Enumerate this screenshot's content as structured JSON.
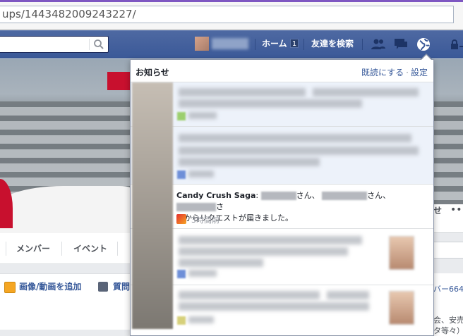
{
  "browser": {
    "url": "ups/1443482009243227/"
  },
  "topbar": {
    "home_label": "ホーム",
    "home_count": "1",
    "find_friends_label": "友達を検索",
    "icons": [
      "search-icon",
      "friend-requests-icon",
      "messages-icon",
      "notifications-globe-icon",
      "privacy-lock-icon"
    ]
  },
  "group": {
    "tabs": [
      "メンバー",
      "イベント"
    ],
    "composer": {
      "add_photo_label": "画像/動画を追加",
      "question_label": "質問"
    },
    "right_button_label": "せ",
    "right_more": "•••",
    "right_text_1": "バー664",
    "right_text_2": "会、安売",
    "right_text_3": "タ等々）"
  },
  "notifications": {
    "title": "お知らせ",
    "mark_read": "既読にする",
    "separator": "·",
    "settings": "設定",
    "candy": {
      "app_name": "Candy Crush Saga",
      "colon": ":",
      "suffix_1": "さん、",
      "suffix_2": "さん、",
      "suffix_3": "さ",
      "line2": "んからリクエストが届きました。",
      "time": "3時間前"
    }
  },
  "colors": {
    "fb_blue": "#3b5998",
    "link": "#365899",
    "unread_bg": "#edf2fa",
    "browser_accent": "#7e57c2"
  }
}
